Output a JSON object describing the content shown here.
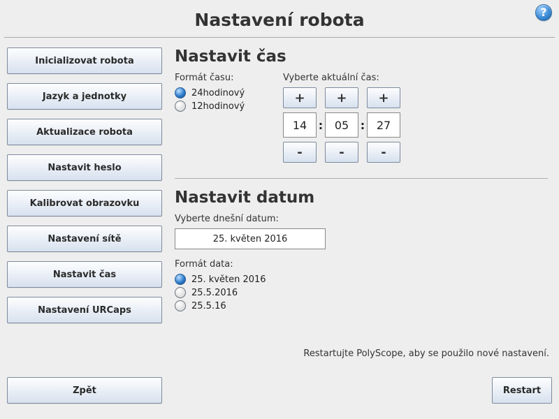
{
  "title": "Nastavení robota",
  "sidebar": {
    "items": [
      "Inicializovat robota",
      "Jazyk a jednotky",
      "Aktualizace robota",
      "Nastavit heslo",
      "Kalibrovat obrazovku",
      "Nastavení sítě",
      "Nastavit čas",
      "Nastavení URCaps"
    ]
  },
  "time": {
    "heading": "Nastavit čas",
    "format_label": "Formát času:",
    "options": {
      "h24": "24hodinový",
      "h12": "12hodinový"
    },
    "selected_format": "h24",
    "pick_label": "Vyberte aktuální čas:",
    "plus": "+",
    "minus": "-",
    "h": "14",
    "m": "05",
    "s": "27"
  },
  "date": {
    "heading": "Nastavit datum",
    "pick_label": "Vyberte dnešní datum:",
    "value": "25. květen 2016",
    "format_label": "Formát data:",
    "options": {
      "long": "25. květen 2016",
      "mid": "25.5.2016",
      "short": "25.5.16"
    },
    "selected_format": "long"
  },
  "note": "Restartujte PolyScope, aby se použilo nové nastavení.",
  "buttons": {
    "back": "Zpět",
    "restart": "Restart",
    "help": "?"
  }
}
